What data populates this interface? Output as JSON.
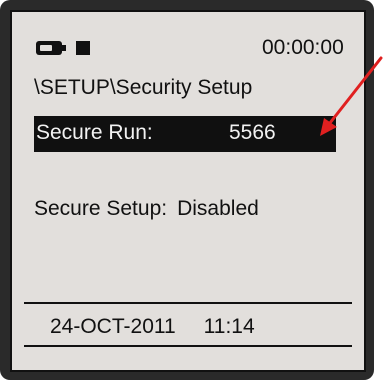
{
  "status_bar": {
    "time": "00:00:00",
    "battery_icon": "battery-icon",
    "indicator_icon": "square-indicator-icon"
  },
  "screen": {
    "path": "\\SETUP\\Security Setup",
    "secure_run": {
      "label": "Secure Run:",
      "value": "5566"
    },
    "secure_setup": {
      "label": "Secure Setup:",
      "value": "Disabled"
    },
    "date": "24-OCT-2011",
    "clock": "11:14"
  },
  "colors": {
    "screen_bg": "#e2dfdc",
    "highlight_bg": "#101010",
    "arrow": "#e02020"
  }
}
